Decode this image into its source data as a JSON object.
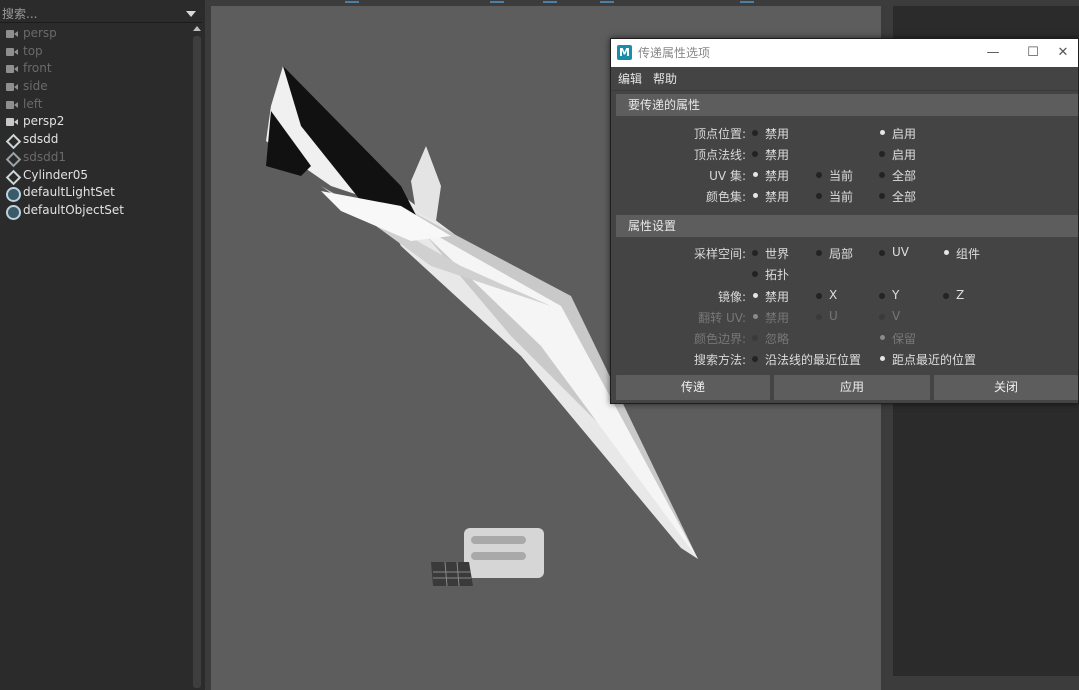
{
  "outliner": {
    "search_placeholder": "搜索...",
    "items": [
      {
        "label": "persp",
        "icon": "camera-icon",
        "active": false
      },
      {
        "label": "top",
        "icon": "camera-icon",
        "active": false
      },
      {
        "label": "front",
        "icon": "camera-icon",
        "active": false
      },
      {
        "label": "side",
        "icon": "camera-icon",
        "active": false
      },
      {
        "label": "left",
        "icon": "camera-icon",
        "active": false
      },
      {
        "label": "persp2",
        "icon": "camera-icon",
        "active": true
      },
      {
        "label": "sdsdd",
        "icon": "mesh-icon",
        "active": true
      },
      {
        "label": "sdsdd1",
        "icon": "mesh-icon",
        "active": false
      },
      {
        "label": "Cylinder05",
        "icon": "mesh-icon",
        "active": true
      },
      {
        "label": "defaultLightSet",
        "icon": "set-icon",
        "active": true
      },
      {
        "label": "defaultObjectSet",
        "icon": "set-icon",
        "active": true
      }
    ]
  },
  "dialog": {
    "app_icon": "M",
    "title": "传递属性选项",
    "window_buttons": {
      "minimize": "—",
      "maximize": "☐",
      "close": "✕"
    },
    "menu": {
      "edit": "编辑",
      "help": "帮助"
    },
    "section1": {
      "title": "要传递的属性",
      "rows": [
        {
          "label": "顶点位置:",
          "options": [
            "禁用",
            "启用"
          ]
        },
        {
          "label": "顶点法线:",
          "options": [
            "禁用",
            "启用"
          ]
        },
        {
          "label": "UV 集:",
          "options": [
            "禁用",
            "当前",
            "全部"
          ]
        },
        {
          "label": "颜色集:",
          "options": [
            "禁用",
            "当前",
            "全部"
          ]
        }
      ]
    },
    "section2": {
      "title": "属性设置",
      "sample_space": {
        "label": "采样空间:",
        "options": [
          "世界",
          "局部",
          "UV",
          "组件",
          "拓扑"
        ]
      },
      "mirror": {
        "label": "镜像:",
        "options": [
          "禁用",
          "X",
          "Y",
          "Z"
        ]
      },
      "flip_uv": {
        "label": "翻转 UV:",
        "options": [
          "禁用",
          "U",
          "V"
        ]
      },
      "color_border": {
        "label": "颜色边界:",
        "options": [
          "忽略",
          "保留"
        ]
      },
      "search_method": {
        "label": "搜索方法:",
        "options": [
          "沿法线的最近位置",
          "距点最近的位置"
        ]
      }
    },
    "buttons": {
      "transfer": "传递",
      "apply": "应用",
      "close": "关闭"
    }
  },
  "colors": {
    "viewport_bg": "#5d5d5d",
    "panel_bg": "#2b2b2b",
    "dialog_bg": "#444444",
    "section_header": "#5d5d5d"
  }
}
